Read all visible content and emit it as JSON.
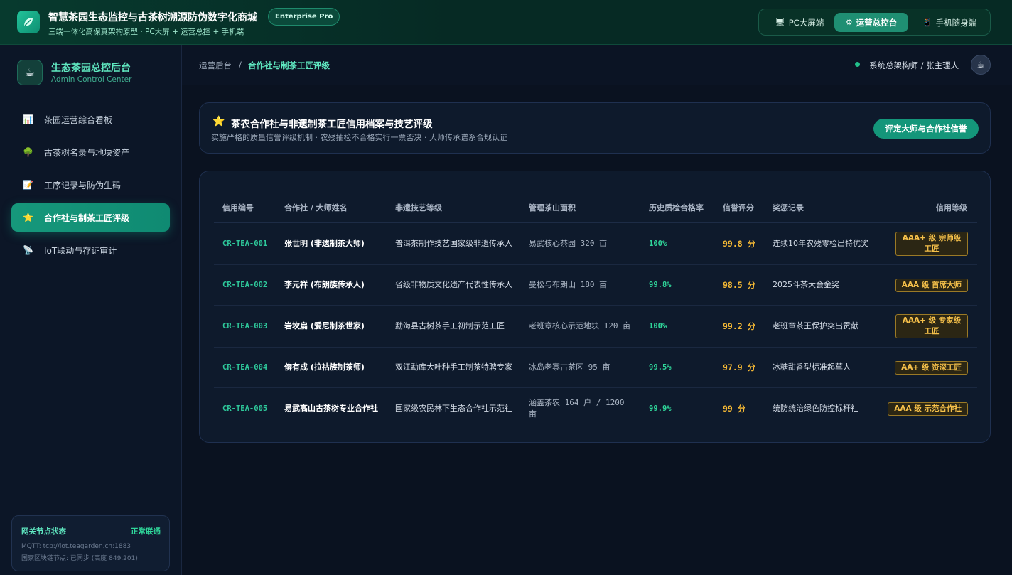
{
  "header": {
    "title": "智慧茶园生态监控与古茶树溯源防伪数字化商城",
    "edition": "Enterprise Pro",
    "subtitle": "三端一体化高保真架构原型 · PC大屏 + 运营总控 + 手机端",
    "views": [
      {
        "label": "PC大屏端",
        "icon": "monitor-icon",
        "glyph": "🖥",
        "active": false
      },
      {
        "label": "运营总控台",
        "icon": "gear-icon",
        "glyph": "⚙",
        "active": true
      },
      {
        "label": "手机随身端",
        "icon": "phone-icon",
        "glyph": "📱",
        "active": false
      }
    ]
  },
  "sidebar": {
    "title": "生态茶园总控后台",
    "subtitle": "Admin Control Center",
    "items": [
      {
        "label": "茶园运营综合看板",
        "icon": "chart-icon",
        "glyph": "📊",
        "active": false
      },
      {
        "label": "古茶树名录与地块资产",
        "icon": "tree-icon",
        "glyph": "🌳",
        "active": false
      },
      {
        "label": "工序记录与防伪生码",
        "icon": "document-icon",
        "glyph": "📝",
        "active": false
      },
      {
        "label": "合作社与制茶工匠评级",
        "icon": "star-icon",
        "glyph": "⭐",
        "active": true
      },
      {
        "label": "IoT联动与存证审计",
        "icon": "signal-icon",
        "glyph": "📡",
        "active": false
      }
    ],
    "gateway": {
      "title": "网关节点状态",
      "status": "正常联通",
      "mqtt": "MQTT: tcp://iot.teagarden.cn:1883",
      "chain": "国家区块链节点: 已同步 (高度 849,201)"
    }
  },
  "breadcrumb": {
    "root": "运营后台",
    "separator": "/",
    "current": "合作社与制茶工匠评级"
  },
  "user": {
    "label": "系统总架构师 / 张主理人",
    "avatar_glyph": "☕"
  },
  "hero": {
    "title": "茶农合作社与非遗制茶工匠信用档案与技艺评级",
    "description": "实施严格的质量信誉评级机制 · 农残抽检不合格实行一票否决 · 大师传承谱系合规认证",
    "button_label": "评定大师与合作社信誉"
  },
  "table": {
    "columns": [
      "信用编号",
      "合作社 / 大师姓名",
      "非遗技艺等级",
      "管理茶山面积",
      "历史质检合格率",
      "信誉评分",
      "奖惩记录",
      "信用等级"
    ],
    "rows": [
      {
        "id": "CR-TEA-001",
        "name": "张世明 (非遗制茶大师)",
        "level": "普洱茶制作技艺国家级非遗传承人",
        "area": "易武核心茶园 320 亩",
        "rate": "100%",
        "score": "99.8 分",
        "award": "连续10年农残零检出特优奖",
        "grade": "AAA+ 级 宗师级工匠"
      },
      {
        "id": "CR-TEA-002",
        "name": "李元祥 (布朗族传承人)",
        "level": "省级非物质文化遗产代表性传承人",
        "area": "曼松与布朗山 180 亩",
        "rate": "99.8%",
        "score": "98.5 分",
        "award": "2025斗茶大会金奖",
        "grade": "AAA 级 首席大师"
      },
      {
        "id": "CR-TEA-003",
        "name": "岩坎扁 (爱尼制茶世家)",
        "level": "勐海县古树茶手工初制示范工匠",
        "area": "老班章核心示范地块 120 亩",
        "rate": "100%",
        "score": "99.2 分",
        "award": "老班章茶王保护突出贡献",
        "grade": "AAA+ 级 专家级工匠"
      },
      {
        "id": "CR-TEA-004",
        "name": "倴有成 (拉祜族制茶师)",
        "level": "双江勐库大叶种手工制茶特聘专家",
        "area": "冰岛老寨古茶区 95 亩",
        "rate": "99.5%",
        "score": "97.9 分",
        "award": "冰糖甜香型标准起草人",
        "grade": "AA+ 级 资深工匠"
      },
      {
        "id": "CR-TEA-005",
        "name": "易武高山古茶树专业合作社",
        "level": "国家级农民林下生态合作社示范社",
        "area": "涵盖茶农 164 户 / 1200 亩",
        "rate": "99.9%",
        "score": "99 分",
        "award": "统防统治绿色防控标杆社",
        "grade": "AAA 级 示范合作社"
      }
    ]
  },
  "colors": {
    "accent": "#14967a",
    "accent_text": "#5fe7c0",
    "gold": "#f5b935",
    "success": "#2fd69a",
    "background": "#0a1220"
  }
}
